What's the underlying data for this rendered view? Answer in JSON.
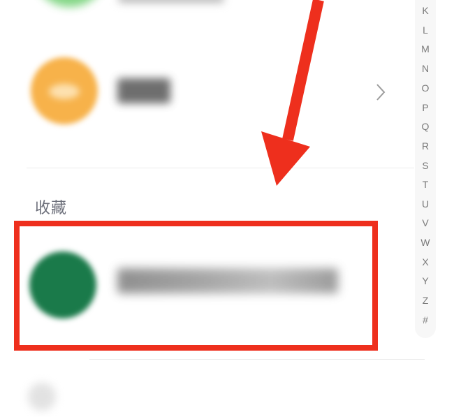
{
  "contacts": {
    "section_header": "收藏"
  },
  "alphabet_index": [
    "K",
    "L",
    "M",
    "N",
    "O",
    "P",
    "Q",
    "R",
    "S",
    "T",
    "U",
    "V",
    "W",
    "X",
    "Y",
    "Z",
    "#"
  ],
  "colors": {
    "accent_red": "#ee2f1d",
    "index_text": "#7a7a7a",
    "section_text": "#6c6f7a",
    "avatar_orange": "#f7b24a",
    "avatar_green": "#1a7a4a"
  },
  "icons": {
    "chevron": "chevron-right-icon",
    "arrow": "red-arrow-annotation"
  }
}
